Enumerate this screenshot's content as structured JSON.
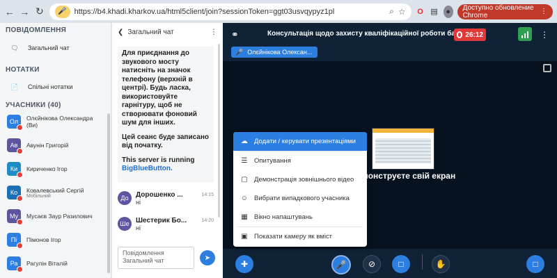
{
  "browser": {
    "url": "https://b4.khadi.kharkov.ua/html5client/join?sessionToken=ggt03usvqypyz1pl",
    "update_label": "Доступно обновление Chrome"
  },
  "sidebar": {
    "messages_header": "ПОВІДОМЛЕННЯ",
    "public_chat": "Загальний чат",
    "notes_header": "НОТАТКИ",
    "shared_notes": "Спільні нотатки",
    "users_header": "УЧАСНИКИ (40)",
    "users": [
      {
        "initials": "Ол",
        "name": "Олєйнікова Олександра (Ви)",
        "sub": "",
        "color": "#2c7ee0"
      },
      {
        "initials": "Ав",
        "name": "Авунін Григорій",
        "sub": "",
        "color": "#5c55a0"
      },
      {
        "initials": "Ки",
        "name": "Кириченко Ігор",
        "sub": "",
        "color": "#1e8bc3"
      },
      {
        "initials": "Ко",
        "name": "Ковалевський Сергій",
        "sub": "Мобільний",
        "color": "#1d6fb5"
      },
      {
        "initials": "Му",
        "name": "Мусаєв Заур Разилович",
        "sub": "",
        "color": "#5c55a0"
      },
      {
        "initials": "Пі",
        "name": "Пімонов Ігор",
        "sub": "",
        "color": "#2c7ee0"
      },
      {
        "initials": "Ра",
        "name": "Рагулін Віталій",
        "sub": "",
        "color": "#2c7ee0"
      }
    ]
  },
  "chat": {
    "title": "Загальний чат",
    "welcome_p1": "Для приєднання до звукового мосту натисніть на значок телефону (верхній в центрі). Будь ласка, використовуйте гарнітуру, щоб не створювати фоновий шум для інших.",
    "welcome_p2": "Цей сеанс буде записано від початку.",
    "welcome_p3": "This server is running",
    "welcome_link": "BigBlueButton.",
    "messages": [
      {
        "initials": "До",
        "name": "Дорошенко ...",
        "time": "14:15",
        "text": "ні"
      },
      {
        "initials": "Ше",
        "name": "Шестерик Бо...",
        "time": "14:20",
        "text": "ні"
      }
    ],
    "input_placeholder": "Повідомлення Загальний чат"
  },
  "main": {
    "meeting_title": "Консультація щодо захисту кваліфікаційної роботи ба...",
    "recording_time": "26:12",
    "talker": "Олєйнікова Олексан...",
    "stage_text": "монструєте свій екран",
    "menu": [
      {
        "icon": "upload-icon",
        "label": "Додати / керувати презентаціями",
        "active": true
      },
      {
        "icon": "poll-icon",
        "label": "Опитування",
        "active": false
      },
      {
        "icon": "external-video-icon",
        "label": "Демонстрація зовнішнього відео",
        "active": false
      },
      {
        "icon": "random-user-icon",
        "label": "Вибрати випадкового учасника",
        "active": false
      },
      {
        "icon": "layout-icon",
        "label": "Вікно напаштувань",
        "active": false
      },
      {
        "icon": "camera-icon",
        "label": "Показати камеру як вміст",
        "active": false
      }
    ]
  }
}
